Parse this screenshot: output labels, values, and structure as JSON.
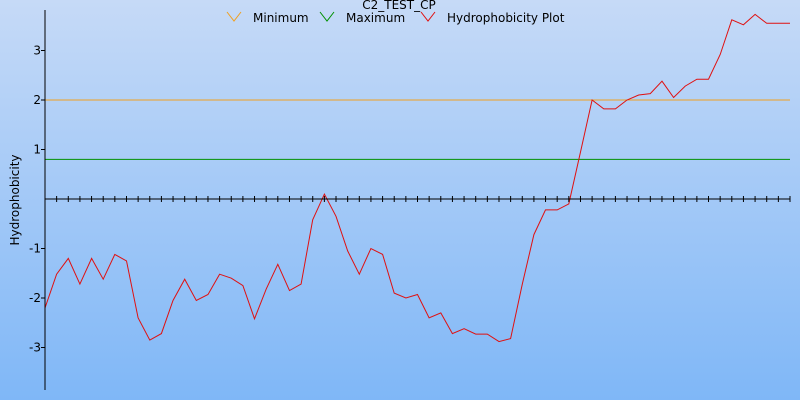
{
  "chart_data": {
    "type": "line",
    "title": "C2_TEST_CP",
    "ylabel": "Hydrophobicity",
    "xlabel": "",
    "ylim": [
      -3.8,
      3.8
    ],
    "yticks": [
      -3,
      -2,
      -1,
      1,
      2,
      3
    ],
    "grid": false,
    "legend_position": "top",
    "background": {
      "top": "#c6daf7",
      "bottom": "#7fb7f7"
    },
    "thresholds": [
      {
        "name": "Minimum",
        "value": 2.0,
        "color": "#f0a020"
      },
      {
        "name": "Maximum",
        "value": 0.8,
        "color": "#009000"
      }
    ],
    "series": [
      {
        "name": "Hydrophobicity Plot",
        "color": "#e01010",
        "x": [
          1,
          2,
          3,
          4,
          5,
          6,
          7,
          8,
          9,
          10,
          11,
          12,
          13,
          14,
          15,
          16,
          17,
          18,
          19,
          20,
          21,
          22,
          23,
          24,
          25,
          26,
          27,
          28,
          29,
          30,
          31,
          32,
          33,
          34,
          35,
          36,
          37,
          38,
          39,
          40,
          41,
          42,
          43,
          44,
          45,
          46,
          47,
          48,
          49,
          50,
          51,
          52,
          53,
          54,
          55,
          56,
          57,
          58,
          59,
          60,
          61,
          62,
          63,
          64,
          65
        ],
        "values": [
          -2.2,
          -1.52,
          -1.2,
          -1.72,
          -1.2,
          -1.62,
          -1.12,
          -1.25,
          -2.4,
          -2.85,
          -2.72,
          -2.05,
          -1.62,
          -2.05,
          -1.93,
          -1.52,
          -1.6,
          -1.75,
          -2.42,
          -1.82,
          -1.32,
          -1.85,
          -1.72,
          -0.42,
          0.1,
          -0.35,
          -1.05,
          -1.52,
          -1.0,
          -1.12,
          -1.9,
          -2.0,
          -1.93,
          -2.4,
          -2.3,
          -2.72,
          -2.62,
          -2.73,
          -2.73,
          -2.88,
          -2.82,
          -1.72,
          -0.72,
          -0.22,
          -0.22,
          -0.1,
          0.95,
          2.0,
          1.82,
          1.82,
          2.0,
          2.1,
          2.13,
          2.38,
          2.05,
          2.28,
          2.42,
          2.42,
          2.92,
          3.62,
          3.52,
          3.73,
          3.55,
          3.55,
          3.55
        ]
      }
    ]
  }
}
